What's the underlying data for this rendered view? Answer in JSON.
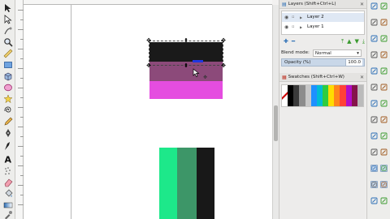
{
  "toolbox": {
    "tools": [
      {
        "icon": "selector-arrow-icon"
      },
      {
        "icon": "node-edit-icon"
      },
      {
        "icon": "tweak-icon"
      },
      {
        "icon": "zoom-icon"
      },
      {
        "icon": "measure-icon"
      },
      {
        "icon": "rectangle-icon"
      },
      {
        "icon": "3d-box-icon"
      },
      {
        "icon": "ellipse-icon"
      },
      {
        "icon": "star-icon"
      },
      {
        "icon": "spiral-icon"
      },
      {
        "icon": "pencil-icon"
      },
      {
        "icon": "pen-icon"
      },
      {
        "icon": "calligraphy-icon"
      },
      {
        "icon": "text-icon"
      },
      {
        "icon": "spray-icon"
      },
      {
        "icon": "eraser-icon"
      },
      {
        "icon": "paint-bucket-icon"
      },
      {
        "icon": "gradient-icon"
      },
      {
        "icon": "mesh-icon"
      },
      {
        "icon": "dropper-icon"
      }
    ]
  },
  "layers_dialog": {
    "title": "Layers (Shift+Ctrl+L)",
    "layers": [
      {
        "name": "Layer 2",
        "selected": true
      },
      {
        "name": "Layer 1",
        "selected": false
      }
    ],
    "blend_label": "Blend mode:",
    "blend_value": "Normal",
    "opacity_label": "Opacity (%)",
    "opacity_value": "100.0"
  },
  "swatches_dialog": {
    "title": "Swatches (Shift+Ctrl+W)",
    "colors": [
      "#ffffff",
      "#000000",
      "#3a3a3a",
      "#8c8c8c",
      "#c8c8c8",
      "#1e90ff",
      "#00bcd4",
      "#2ecc40",
      "#ffdc00",
      "#ff851b",
      "#ff4136",
      "#b10dc9",
      "#85144b",
      "#bbbbbb"
    ]
  },
  "canvas": {
    "objects": [
      {
        "name": "black-rect",
        "color": "#1a1a1a"
      },
      {
        "name": "plum-rect",
        "color": "#8c4a7a"
      },
      {
        "name": "magenta-rect",
        "color": "#e54de0"
      },
      {
        "name": "green-bar",
        "color": "#1de88a"
      },
      {
        "name": "teal-bar",
        "color": "#3d9668"
      },
      {
        "name": "dark-bar",
        "color": "#181818"
      }
    ]
  },
  "commands_bar": {
    "icons": [
      "new-document-icon",
      "open-icon",
      "save-icon",
      "print-icon",
      "import-icon",
      "export-icon",
      "undo-icon",
      "redo-icon",
      "copy-icon",
      "paste-icon",
      "zoom-fit-icon",
      "zoom-drawing-icon",
      "duplicate-icon",
      "clone-icon",
      "group-icon",
      "ungroup-icon",
      "fill-stroke-icon",
      "text-font-icon",
      "xml-editor-icon",
      "align-icon",
      "snap-enable-icon",
      "snap-bbox-icon",
      "snap-nodes-icon",
      "snap-guide-icon",
      "snap-grid-icon",
      "snap-page-icon"
    ]
  },
  "colors": {
    "accent": "#2a6db5",
    "selection_row": "#dfe8f4",
    "opacity_bar": "#c9d7e8"
  }
}
